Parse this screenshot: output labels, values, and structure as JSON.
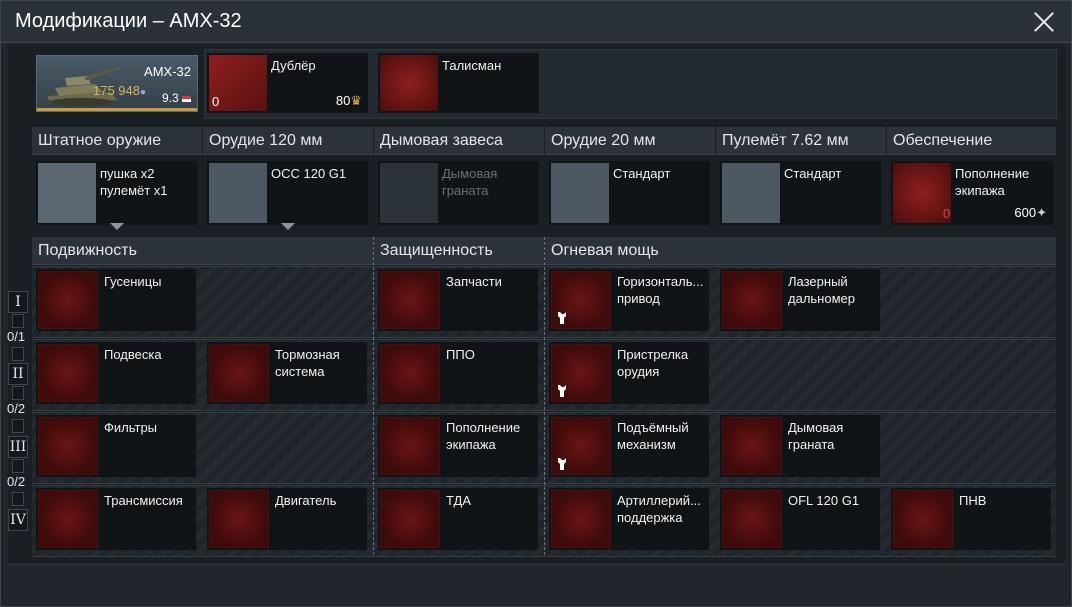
{
  "window": {
    "title": "Модификации – AMX-32"
  },
  "vehicle": {
    "name": "AMX-32",
    "price": "175 948",
    "br": "9.3"
  },
  "crew_slots": [
    {
      "label": "Дублёр",
      "count": "0",
      "cost": "80"
    },
    {
      "label": "Талисман"
    }
  ],
  "weapons": {
    "headers": [
      "Штатное оружие",
      "Орудие 120 мм",
      "Дымовая завеса",
      "Орудие 20 мм",
      "Пулемёт 7.62 мм",
      "Обеспечение"
    ],
    "standard": [
      "пушка x2",
      "пулемёт x1"
    ],
    "gun120": "OCC 120 G1",
    "smoke": [
      "Дымовая",
      "граната"
    ],
    "gun20": "Стандарт",
    "mg": "Стандарт",
    "support": {
      "label": [
        "Пополнение",
        "экипажа"
      ],
      "count": "0",
      "cost": "600"
    }
  },
  "categories": [
    "Подвижность",
    "Защищенность",
    "Огневая мощь"
  ],
  "tiers": [
    {
      "roman": "I",
      "ratio": "0/1"
    },
    {
      "roman": "II",
      "ratio": "0/2"
    },
    {
      "roman": "III",
      "ratio": "0/2"
    },
    {
      "roman": "IV"
    }
  ],
  "mods": {
    "row1": {
      "mobility": [
        "Гусеницы"
      ],
      "protection": [
        "Запчасти"
      ],
      "firepower": [
        "Горизонталь...",
        "привод",
        "Лазерный",
        "дальномер"
      ]
    },
    "row2": {
      "mobility": [
        "Подвеска",
        "Тормозная",
        "система"
      ],
      "protection": [
        "ППО"
      ],
      "firepower": [
        "Пристрелка",
        "орудия"
      ]
    },
    "row3": {
      "mobility": [
        "Фильтры"
      ],
      "protection": [
        "Пополнение",
        "экипажа"
      ],
      "firepower": [
        "Подъёмный",
        "механизм",
        "Дымовая",
        "граната"
      ]
    },
    "row4": {
      "mobility": [
        "Трансмиссия",
        "Двигатель"
      ],
      "protection": [
        "ТДА"
      ],
      "firepower": [
        "Артиллерий...",
        "поддержка",
        "OFL 120 G1",
        "ПНВ"
      ]
    }
  },
  "colors": {
    "accent_gold": "#c99b3a",
    "locked_red": "#6b1414",
    "count_red": "#e04545"
  }
}
